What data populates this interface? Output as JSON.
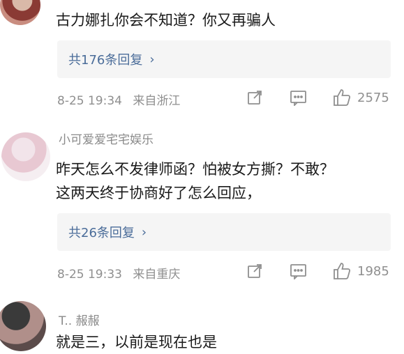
{
  "comments": [
    {
      "username": "",
      "text_lines": [
        "古力娜扎你会不知道？你又再骗人"
      ],
      "reply_label": "共176条回复",
      "date": "8-25 19:34",
      "location": "来自浙江",
      "likes": "2575"
    },
    {
      "username": "小可爱爱宅宅娱乐",
      "text_lines": [
        "昨天怎么不发律师函？怕被女方撕？不敢？",
        "这两天终于协商好了怎么回应，"
      ],
      "reply_label": "共26条回复",
      "date": "8-25 19:33",
      "location": "来自重庆",
      "likes": "1985"
    },
    {
      "username": "T.. 赧赧",
      "text_lines": [
        "就是三，以前是现在也是"
      ]
    }
  ],
  "icons": {
    "share": "share-icon",
    "comment": "comment-icon",
    "like": "thumbs-up-icon",
    "chevron": "chevron-right-icon"
  },
  "colors": {
    "reply_link": "#4a6c99",
    "meta_gray": "#8f8f8f",
    "reply_bg": "#f5f5f5"
  }
}
